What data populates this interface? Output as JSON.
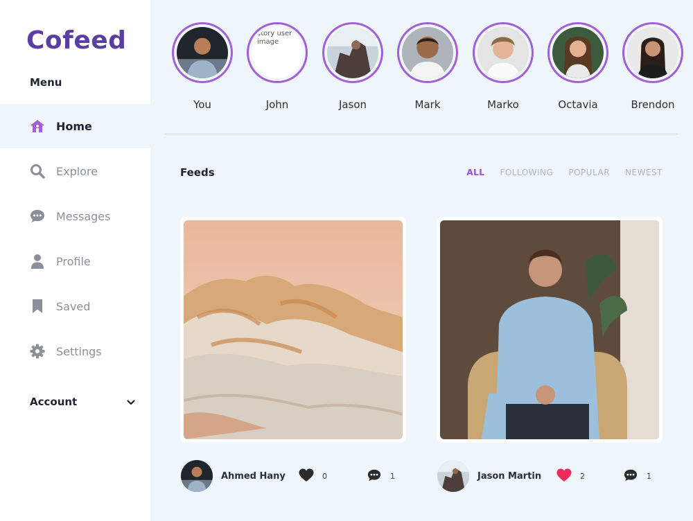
{
  "app": {
    "brand": "Cofeed"
  },
  "sidebar": {
    "menu_label": "Menu",
    "items": [
      {
        "label": "Home",
        "icon": "home-icon",
        "active": true
      },
      {
        "label": "Explore",
        "icon": "search-icon",
        "active": false
      },
      {
        "label": "Messages",
        "icon": "chat-bubble-icon",
        "active": false
      },
      {
        "label": "Profile",
        "icon": "user-icon",
        "active": false
      },
      {
        "label": "Saved",
        "icon": "bookmark-icon",
        "active": false
      },
      {
        "label": "Settings",
        "icon": "gear-icon",
        "active": false
      }
    ],
    "account_label": "Account"
  },
  "stories": [
    {
      "name": "You"
    },
    {
      "name": "John",
      "alt": "story user image"
    },
    {
      "name": "Jason"
    },
    {
      "name": "Mark"
    },
    {
      "name": "Marko"
    },
    {
      "name": "Octavia"
    },
    {
      "name": "Brendon"
    }
  ],
  "feeds": {
    "title": "Feeds",
    "filters": [
      "ALL",
      "FOLLOWING",
      "POPULAR",
      "NEWEST"
    ],
    "active_filter": "ALL"
  },
  "posts": [
    {
      "author": "Ahmed Hany",
      "likes": "0",
      "comments": "1",
      "liked": false
    },
    {
      "author": "Jason Martin",
      "likes": "2",
      "comments": "1",
      "liked": true
    }
  ],
  "colors": {
    "brand": "#5a3fa0",
    "accent": "#a35fd6",
    "like": "#ee2a5a",
    "background": "#eef6fb"
  }
}
